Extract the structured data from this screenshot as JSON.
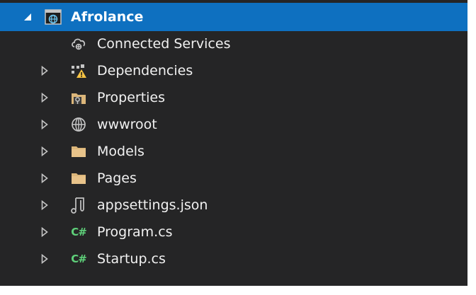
{
  "solution_explorer": {
    "root": {
      "label": "Afrolance",
      "icon": "web-project-icon",
      "expanded": true
    },
    "items": [
      {
        "label": "Connected Services",
        "icon": "connected-services-icon",
        "expandable": false
      },
      {
        "label": "Dependencies",
        "icon": "dependencies-warning-icon",
        "expandable": true
      },
      {
        "label": "Properties",
        "icon": "properties-folder-icon",
        "expandable": true
      },
      {
        "label": "wwwroot",
        "icon": "globe-icon",
        "expandable": true
      },
      {
        "label": "Models",
        "icon": "folder-icon",
        "expandable": true
      },
      {
        "label": "Pages",
        "icon": "folder-icon",
        "expandable": true
      },
      {
        "label": "appsettings.json",
        "icon": "json-file-icon",
        "expandable": true
      },
      {
        "label": "Program.cs",
        "icon": "csharp-file-icon",
        "expandable": true
      },
      {
        "label": "Startup.cs",
        "icon": "csharp-file-icon",
        "expandable": true
      }
    ],
    "csharp_badge": "C#",
    "colors": {
      "background": "#252526",
      "selection": "#0e70c0",
      "text": "#f1f1f1",
      "folder": "#dcb67a",
      "csharp": "#5fd17a",
      "warning": "#f6c343"
    }
  }
}
